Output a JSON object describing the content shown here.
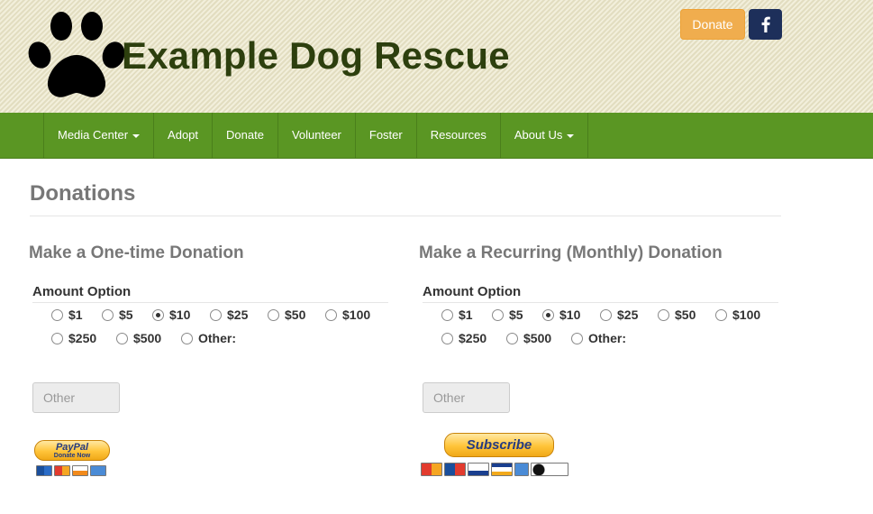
{
  "header": {
    "site_title": "Example Dog Rescue",
    "donate_button": "Donate",
    "facebook_icon": "f"
  },
  "nav": {
    "items": [
      {
        "label": "Media Center",
        "dropdown": true
      },
      {
        "label": "Adopt",
        "dropdown": false
      },
      {
        "label": "Donate",
        "dropdown": false
      },
      {
        "label": "Volunteer",
        "dropdown": false
      },
      {
        "label": "Foster",
        "dropdown": false
      },
      {
        "label": "Resources",
        "dropdown": false
      },
      {
        "label": "About Us",
        "dropdown": true
      }
    ]
  },
  "page": {
    "title": "Donations"
  },
  "one_time": {
    "heading": "Make a One-time Donation",
    "amount_label": "Amount Option",
    "options": [
      "$1",
      "$5",
      "$10",
      "$25",
      "$50",
      "$100",
      "$250",
      "$500",
      "Other:"
    ],
    "selected": "$10",
    "other_placeholder": "Other",
    "paypal": {
      "brand": "PayPal",
      "caption": "Donate Now"
    }
  },
  "recurring": {
    "heading": "Make a Recurring (Monthly) Donation",
    "amount_label": "Amount Option",
    "options": [
      "$1",
      "$5",
      "$10",
      "$25",
      "$50",
      "$100",
      "$250",
      "$500",
      "Other:"
    ],
    "selected": "$10",
    "other_placeholder": "Other",
    "subscribe": {
      "label": "Subscribe"
    }
  },
  "colors": {
    "nav_green": "#5a9623",
    "title_green": "#2d3f0e",
    "donate_orange": "#f0ad4e",
    "facebook_navy": "#1d2f5a",
    "paypal_yellow": "#ffc439",
    "paypal_blue": "#253b80"
  },
  "icons": {
    "logo": "paw-print-icon",
    "facebook": "facebook-icon",
    "caret": "caret-down-icon",
    "cards": [
      "credit-card-icon"
    ]
  }
}
